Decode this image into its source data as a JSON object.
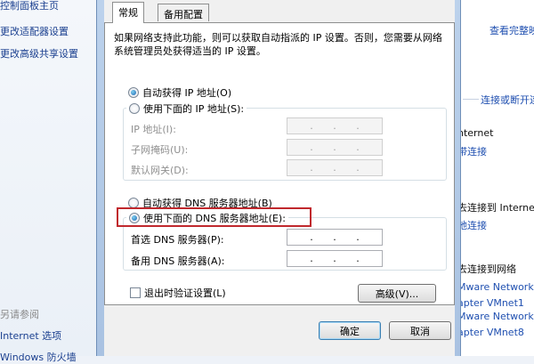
{
  "background_left": {
    "items": [
      {
        "text": "控制面板主页",
        "style": "link"
      },
      {
        "text": "更改适配器设置",
        "style": "link"
      },
      {
        "text": "更改高级共享设置",
        "style": "link"
      },
      {
        "text": "另请参阅",
        "style": "muted"
      },
      {
        "text": "Internet 选项",
        "style": "link"
      },
      {
        "text": "Windows 防火墙",
        "style": "link"
      }
    ]
  },
  "background_right": {
    "items": [
      {
        "text": "查看完整映射",
        "style": "link"
      },
      {
        "text": "连接或断开连接",
        "style": "link"
      },
      {
        "text": "nternet",
        "style": "text"
      },
      {
        "text": "带连接",
        "style": "link"
      },
      {
        "text": "去连接到 Internet",
        "style": "text"
      },
      {
        "text": "地连接",
        "style": "link"
      },
      {
        "text": "去连接到网络",
        "style": "text"
      },
      {
        "text": "Mware Network",
        "style": "link"
      },
      {
        "text": "apter VMnet1",
        "style": "link"
      },
      {
        "text": "Mware Network",
        "style": "link"
      },
      {
        "text": "apter VMnet8",
        "style": "link"
      }
    ]
  },
  "tabs": [
    {
      "label": "常规",
      "active": true
    },
    {
      "label": "备用配置",
      "active": false
    }
  ],
  "description": "如果网络支持此功能，则可以获取自动指派的 IP 设置。否则，您需要从网络系统管理员处获得适当的 IP 设置。",
  "ip": {
    "auto_label": "自动获得 IP 地址(O)",
    "auto_selected": true,
    "manual_label": "使用下面的 IP 地址(S):",
    "manual_selected": false,
    "fields": [
      {
        "label": "IP 地址(I):"
      },
      {
        "label": "子网掩码(U):"
      },
      {
        "label": "默认网关(D):"
      }
    ]
  },
  "dns": {
    "auto_label": "自动获得 DNS 服务器地址(B)",
    "auto_selected": false,
    "manual_label": "使用下面的 DNS 服务器地址(E):",
    "manual_selected": true,
    "fields": [
      {
        "label": "首选 DNS 服务器(P):"
      },
      {
        "label": "备用 DNS 服务器(A):"
      }
    ]
  },
  "validate_label": "退出时验证设置(L)",
  "validate_checked": false,
  "buttons": {
    "advanced": "高级(V)...",
    "ok": "确定",
    "cancel": "取消"
  },
  "colors": {
    "highlight_box": "#c0282d",
    "link": "#1f4fb0"
  }
}
